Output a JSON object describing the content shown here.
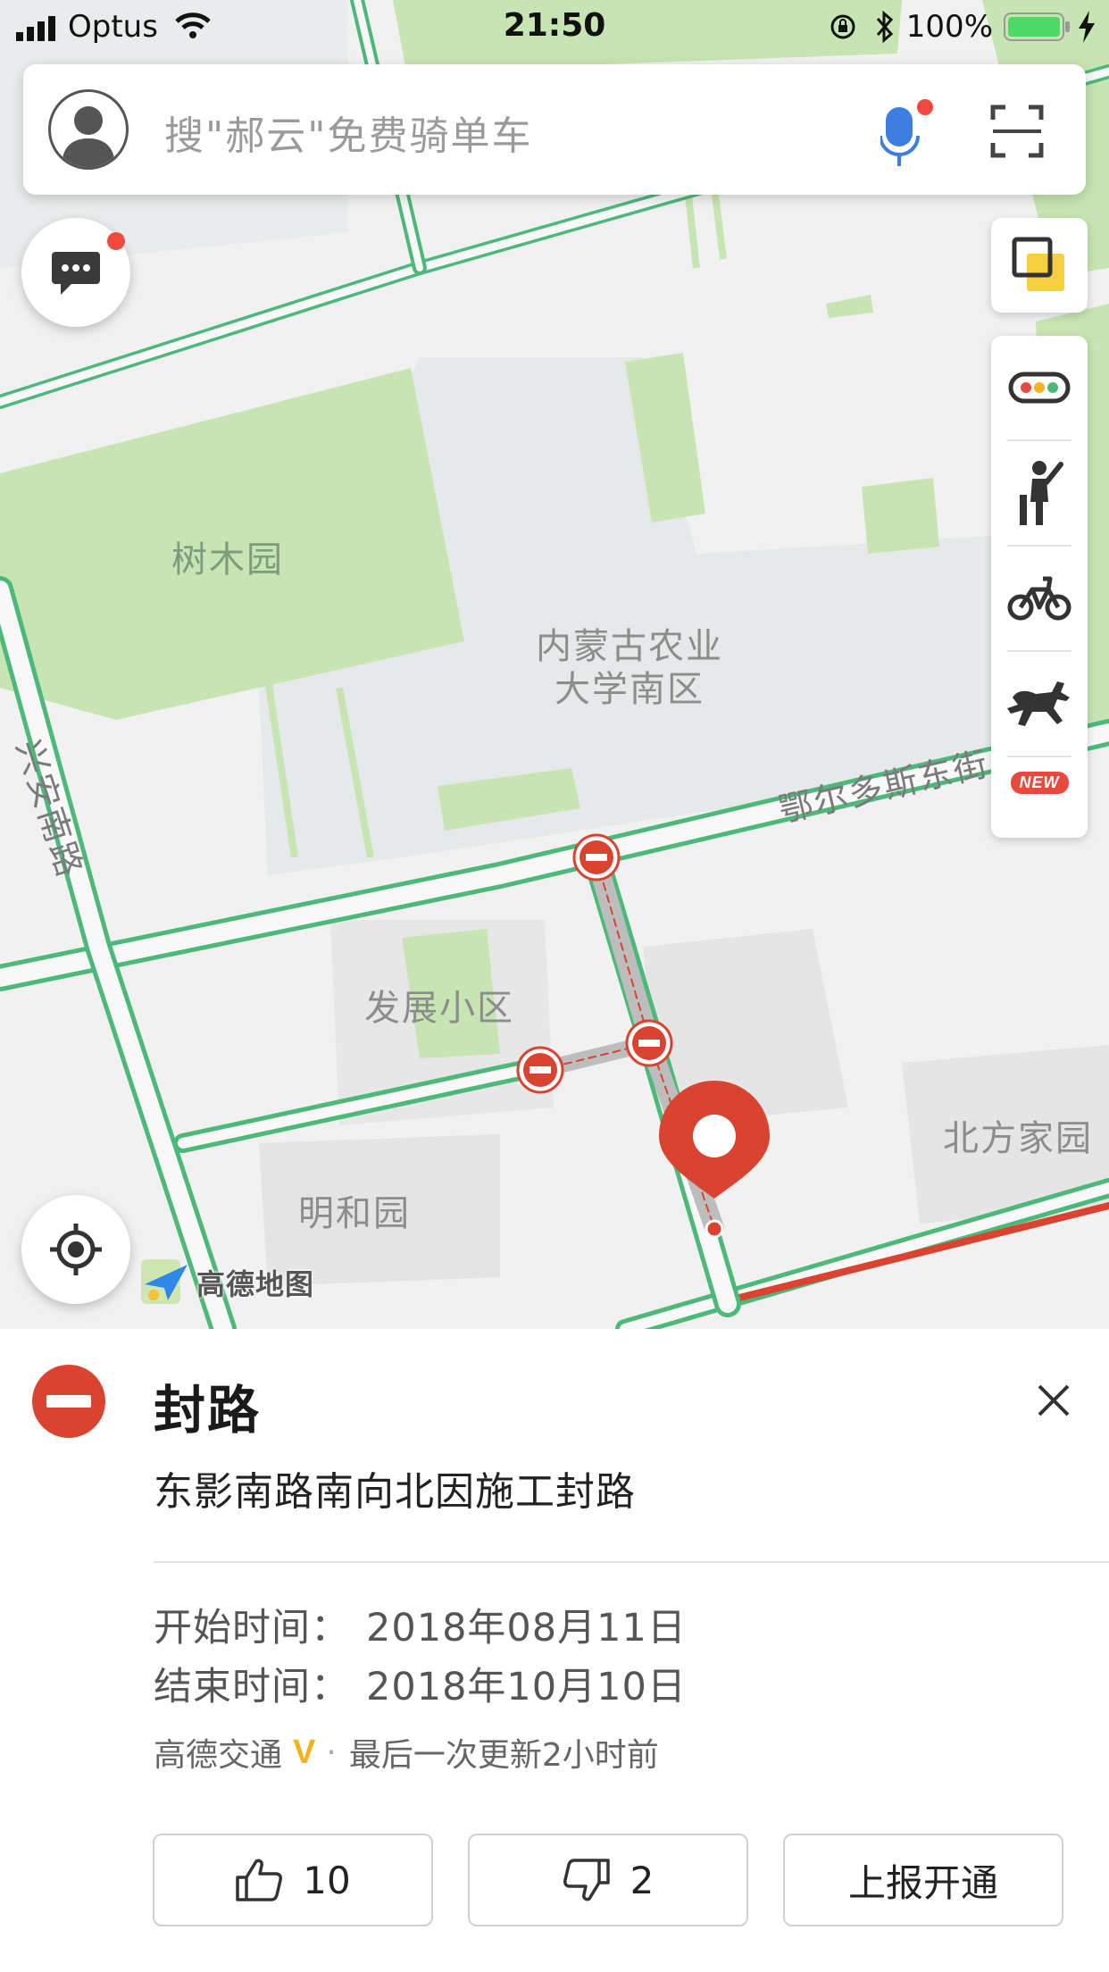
{
  "status_bar": {
    "carrier": "Optus",
    "time": "21:50",
    "battery": "100%"
  },
  "search": {
    "placeholder": "搜\"郝云\"免费骑单车"
  },
  "map": {
    "labels": {
      "shumu_park": "树木园",
      "university": "内蒙古农业\n大学南区",
      "university_line1": "内蒙古农业",
      "university_line2": "大学南区",
      "fazhan": "发展小区",
      "minghe": "明和园",
      "beifang": "北方家园",
      "street_erduosi": "鄂尔多斯东街",
      "street_xingan": "兴安南路"
    },
    "logo_text": "高德地图",
    "right_tools": [
      "traffic-light-icon",
      "pedestrian-icon",
      "bicycle-icon",
      "horse-icon"
    ],
    "new_badge": "NEW",
    "colors": {
      "road_green": "#4cb97a",
      "park_green": "#c8e6b0",
      "closure_red": "#d9432f",
      "block_gray": "#e4e4e4"
    }
  },
  "panel": {
    "title": "封路",
    "description": "东影南路南向北因施工封路",
    "start_label": "开始时间：",
    "start_value": "2018年08月11日",
    "end_label": "结束时间：",
    "end_value": "2018年10月10日",
    "source_name": "高德交通",
    "source_badge": "V",
    "separator": "·",
    "updated": "最后一次更新2小时前",
    "like_count": "10",
    "dislike_count": "2",
    "report_label": "上报开通"
  }
}
